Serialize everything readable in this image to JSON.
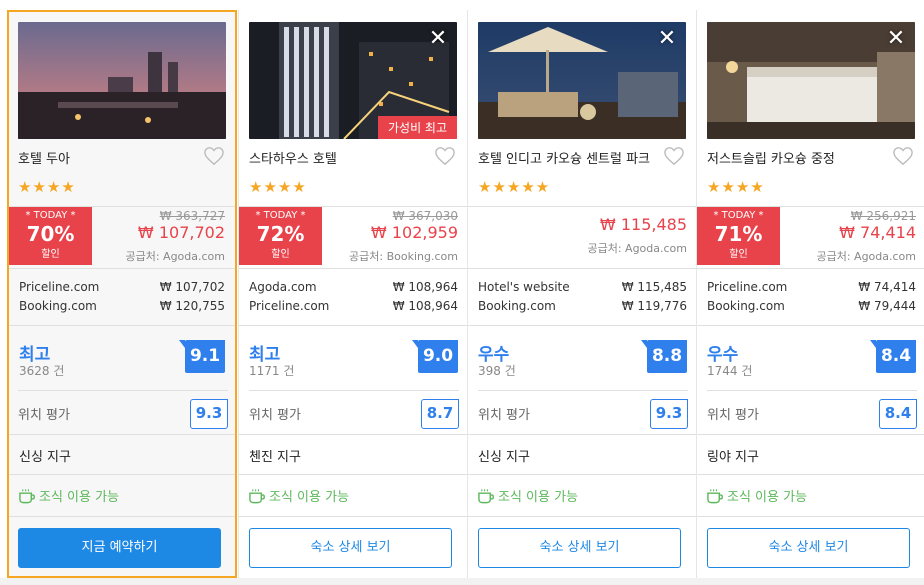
{
  "colors": {
    "accent": "#2f80ed",
    "deal": "#e8434b",
    "star": "#f5a623",
    "breakfast": "#5cb85c",
    "selected_border": "#f5a623"
  },
  "hotels": [
    {
      "name": "호텔 두아",
      "stars": "★★★★",
      "deal": {
        "today": "* TODAY *",
        "percent": "70%",
        "label": "할인"
      },
      "old_price": "₩ 363,727",
      "price": "₩ 107,702",
      "supplier": "공급처: Agoda.com",
      "offers": [
        {
          "site": "Priceline.com",
          "price": "₩ 107,702"
        },
        {
          "site": "Booking.com",
          "price": "₩ 120,755"
        }
      ],
      "rating_label": "최고",
      "review_count": "3628 건",
      "score": "9.1",
      "location_label": "위치 평가",
      "location_score": "9.3",
      "district": "신싱 지구",
      "breakfast": "조식 이용 가능",
      "button": "지금 예약하기"
    },
    {
      "name": "스타하우스 호텔",
      "stars": "★★★★",
      "ribbon": "가성비 최고",
      "deal": {
        "today": "* TODAY *",
        "percent": "72%",
        "label": "할인"
      },
      "old_price": "₩ 367,030",
      "price": "₩ 102,959",
      "supplier": "공급처: Booking.com",
      "offers": [
        {
          "site": "Agoda.com",
          "price": "₩ 108,964"
        },
        {
          "site": "Priceline.com",
          "price": "₩ 108,964"
        }
      ],
      "rating_label": "최고",
      "review_count": "1171 건",
      "score": "9.0",
      "location_label": "위치 평가",
      "location_score": "8.7",
      "district": "첸진 지구",
      "breakfast": "조식 이용 가능",
      "button": "숙소 상세 보기"
    },
    {
      "name": "호텔 인디고 카오슝 센트럴 파크",
      "stars": "★★★★★",
      "price": "₩ 115,485",
      "supplier": "공급처: Agoda.com",
      "offers": [
        {
          "site": "Hotel's website",
          "price": "₩ 115,485"
        },
        {
          "site": "Booking.com",
          "price": "₩ 119,776"
        }
      ],
      "rating_label": "우수",
      "review_count": "398 건",
      "score": "8.8",
      "location_label": "위치 평가",
      "location_score": "9.3",
      "district": "신싱 지구",
      "breakfast": "조식 이용 가능",
      "button": "숙소 상세 보기"
    },
    {
      "name": "저스트슬립 카오슝 중정",
      "stars": "★★★★",
      "deal": {
        "today": "* TODAY *",
        "percent": "71%",
        "label": "할인"
      },
      "old_price": "₩ 256,921",
      "price": "₩ 74,414",
      "supplier": "공급처: Agoda.com",
      "offers": [
        {
          "site": "Priceline.com",
          "price": "₩ 74,414"
        },
        {
          "site": "Booking.com",
          "price": "₩ 79,444"
        }
      ],
      "rating_label": "우수",
      "review_count": "1744 건",
      "score": "8.4",
      "location_label": "위치 평가",
      "location_score": "8.4",
      "district": "링야 지구",
      "breakfast": "조식 이용 가능",
      "button": "숙소 상세 보기"
    }
  ],
  "icons": {
    "close": "close-icon",
    "heart": "heart-icon",
    "breakfast": "coffee-cup-icon"
  }
}
